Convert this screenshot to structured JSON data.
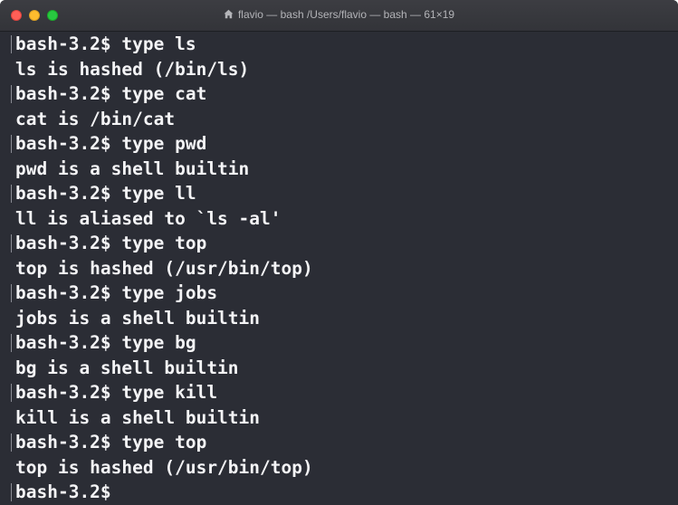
{
  "window": {
    "title": "flavio — bash /Users/flavio — bash — 61×19",
    "title_icon": "home-icon"
  },
  "colors": {
    "background": "#2b2d35",
    "text": "#f4f4f6",
    "close": "#ff5f57",
    "minimize": "#febc2e",
    "zoom": "#28c840"
  },
  "terminal": {
    "lines": [
      {
        "text": "bash-3.2$ type ls",
        "kind": "prompt"
      },
      {
        "text": "ls is hashed (/bin/ls)",
        "kind": "output"
      },
      {
        "text": "bash-3.2$ type cat",
        "kind": "prompt"
      },
      {
        "text": "cat is /bin/cat",
        "kind": "output"
      },
      {
        "text": "bash-3.2$ type pwd",
        "kind": "prompt"
      },
      {
        "text": "pwd is a shell builtin",
        "kind": "output"
      },
      {
        "text": "bash-3.2$ type ll",
        "kind": "prompt"
      },
      {
        "text": "ll is aliased to `ls -al'",
        "kind": "output"
      },
      {
        "text": "bash-3.2$ type top",
        "kind": "prompt"
      },
      {
        "text": "top is hashed (/usr/bin/top)",
        "kind": "output"
      },
      {
        "text": "bash-3.2$ type jobs",
        "kind": "prompt"
      },
      {
        "text": "jobs is a shell builtin",
        "kind": "output"
      },
      {
        "text": "bash-3.2$ type bg",
        "kind": "prompt"
      },
      {
        "text": "bg is a shell builtin",
        "kind": "output"
      },
      {
        "text": "bash-3.2$ type kill",
        "kind": "prompt"
      },
      {
        "text": "kill is a shell builtin",
        "kind": "output"
      },
      {
        "text": "bash-3.2$ type top",
        "kind": "prompt"
      },
      {
        "text": "top is hashed (/usr/bin/top)",
        "kind": "output"
      },
      {
        "text": "bash-3.2$",
        "kind": "prompt"
      }
    ]
  }
}
